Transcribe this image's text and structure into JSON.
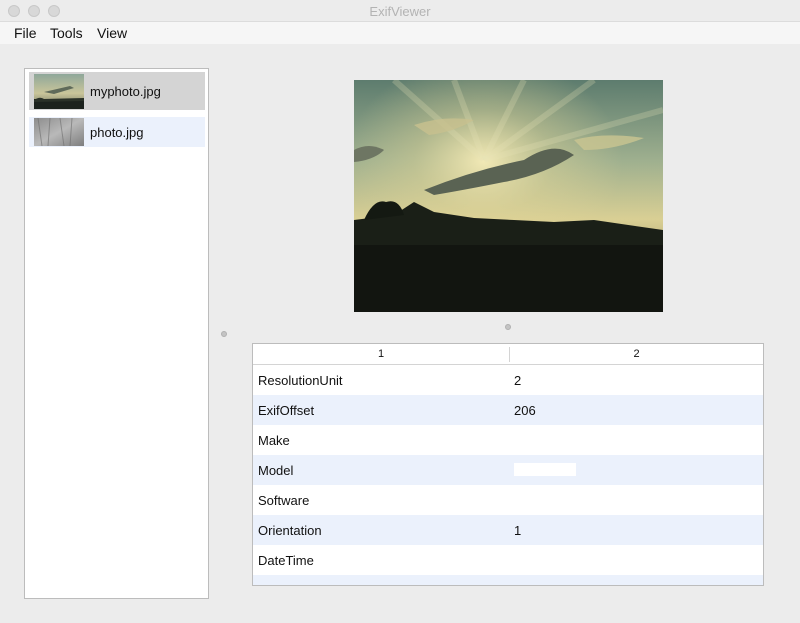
{
  "window": {
    "title": "ExifViewer"
  },
  "menu": {
    "file": "File",
    "tools": "Tools",
    "view": "View"
  },
  "files": [
    {
      "name": "myphoto.jpg",
      "selected": true
    },
    {
      "name": "photo.jpg",
      "selected": false
    }
  ],
  "table": {
    "columns": [
      "1",
      "2"
    ],
    "rows": [
      {
        "key": "ResolutionUnit",
        "value": "2"
      },
      {
        "key": "ExifOffset",
        "value": "206"
      },
      {
        "key": "Make",
        "value": ""
      },
      {
        "key": "Model",
        "value": ""
      },
      {
        "key": "Software",
        "value": ""
      },
      {
        "key": "Orientation",
        "value": "1"
      },
      {
        "key": "DateTime",
        "value": ""
      }
    ]
  },
  "colors": {
    "selected_row": "#d4d4d4",
    "alternate_row": "#ebf1fc"
  }
}
